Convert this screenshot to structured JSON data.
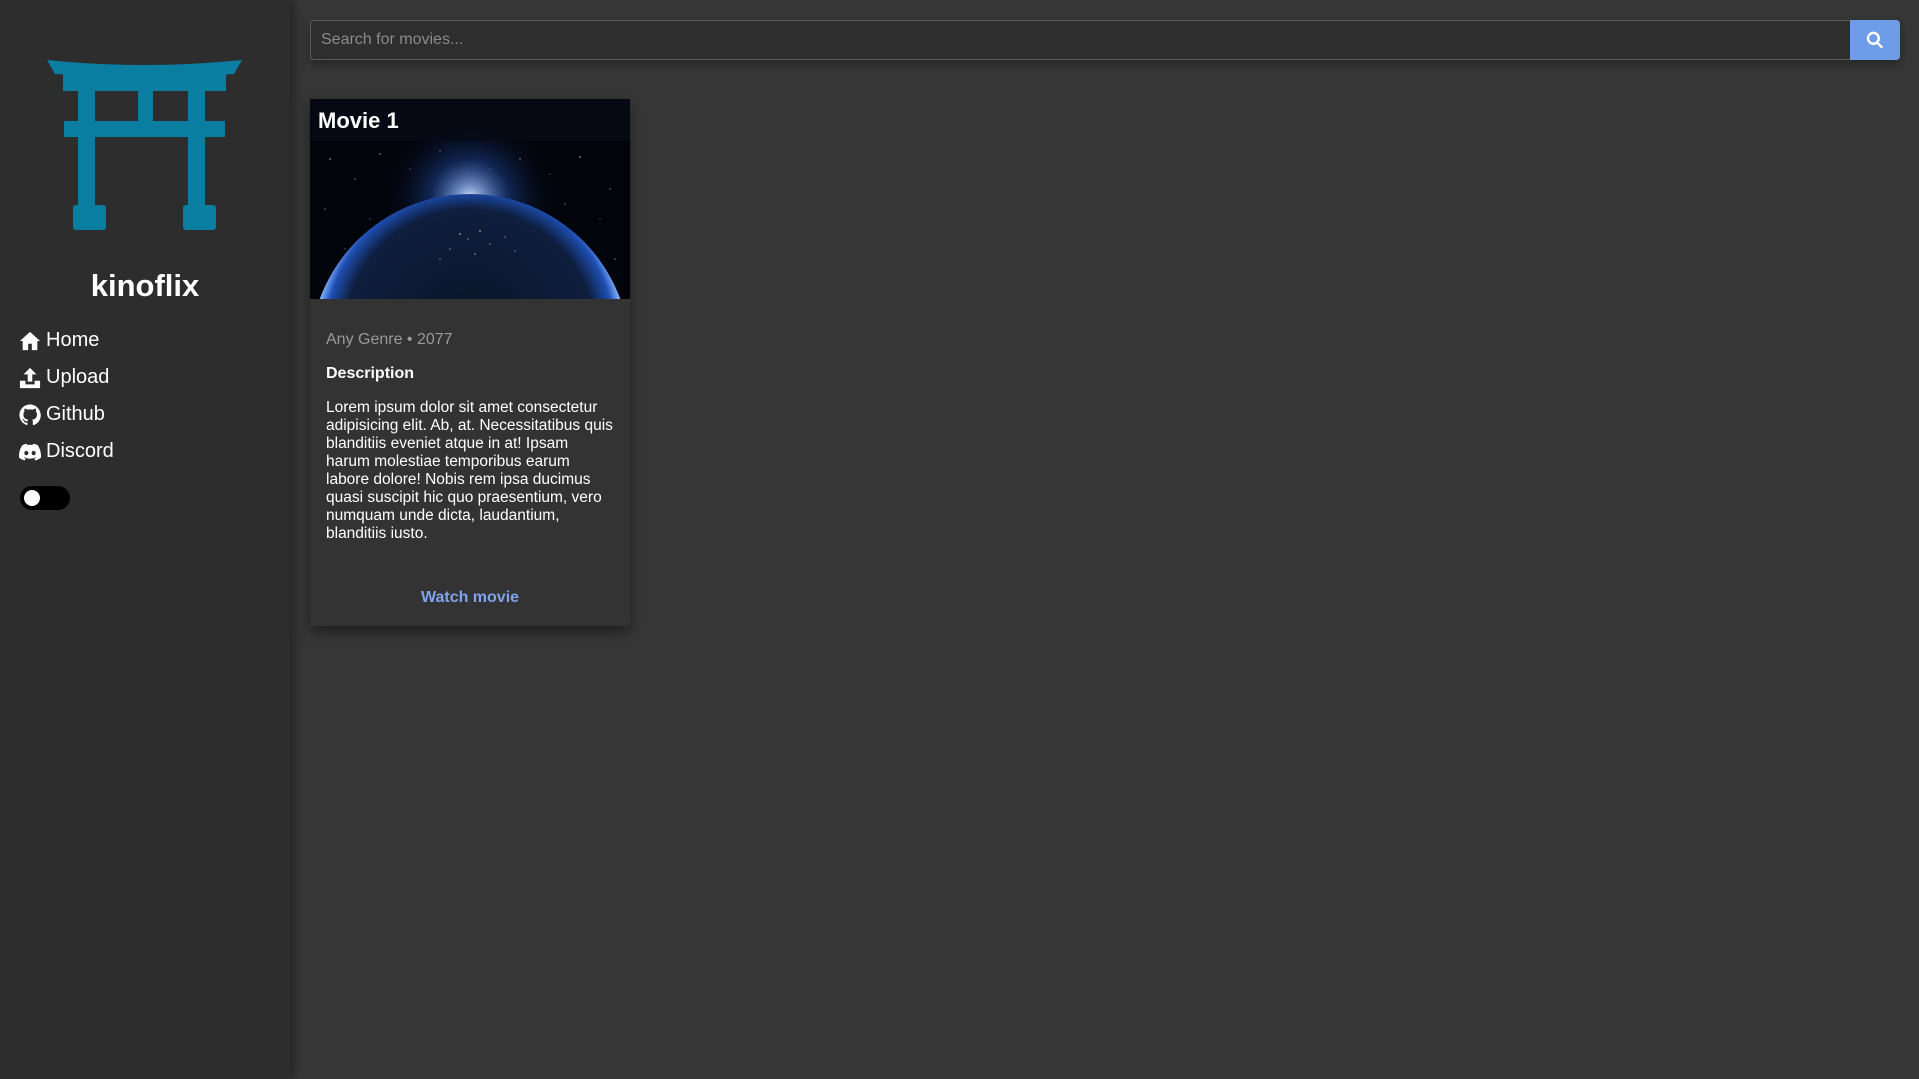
{
  "sidebar": {
    "brand": "kinoflix",
    "logo_color": "#0a7ea0",
    "nav": [
      {
        "label": "Home",
        "icon": "home-icon"
      },
      {
        "label": "Upload",
        "icon": "upload-icon"
      },
      {
        "label": "Github",
        "icon": "github-icon"
      },
      {
        "label": "Discord",
        "icon": "discord-icon"
      }
    ],
    "theme_toggle": {
      "state": "off"
    }
  },
  "search": {
    "placeholder": "Search for movies...",
    "value": "",
    "button_color": "#6f9ce8"
  },
  "movies": [
    {
      "title": "Movie 1",
      "genre": "Any Genre",
      "year": "2077",
      "meta": "Any Genre • 2077",
      "description_heading": "Description",
      "description": "Lorem ipsum dolor sit amet consectetur adipisicing elit. Ab, at. Necessitatibus quis blanditiis eveniet atque in at! Ipsam harum molestiae temporibus earum labore dolore! Nobis rem ipsa ducimus quasi suscipit hic quo praesentium, vero numquam unde dicta, laudantium, blanditiis iusto.",
      "action_label": "Watch movie",
      "action_color": "#7fa4ec"
    }
  ],
  "colors": {
    "background": "#373737",
    "sidebar": "#2d2d2d",
    "card": "#333333"
  }
}
